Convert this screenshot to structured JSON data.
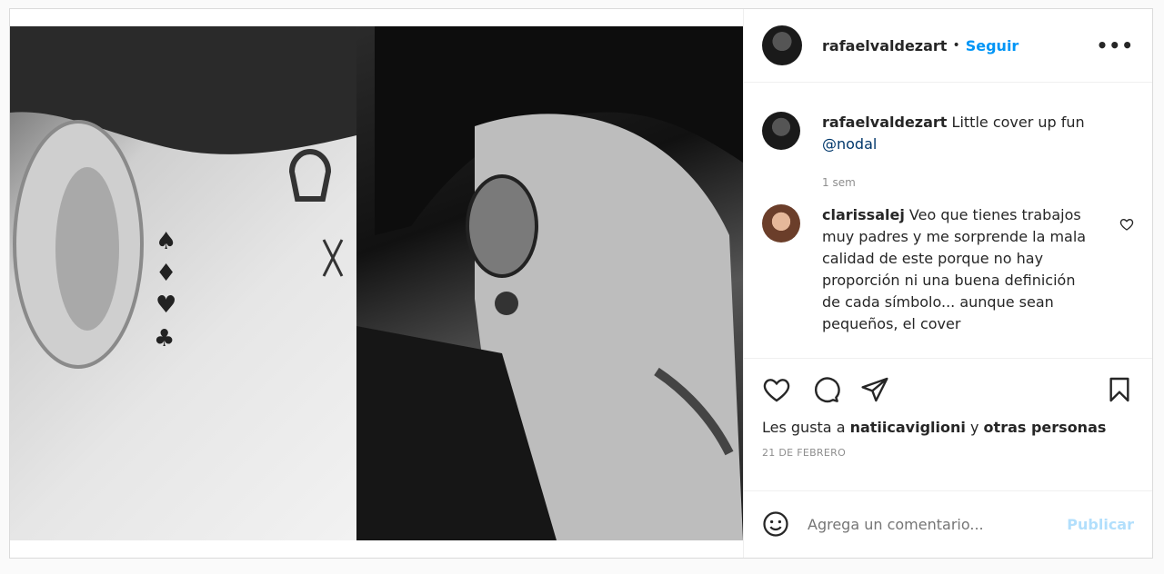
{
  "post": {
    "author": "rafaelvaldezart",
    "follow_label": "Seguir",
    "more_label": "•••"
  },
  "caption": {
    "user": "rafaelvaldezart",
    "text": "Little cover up fun",
    "mention": "@nodal",
    "time": "1 sem"
  },
  "comments": [
    {
      "user": "clarissalej",
      "text": "Veo que tienes trabajos muy padres y me sorprende la mala calidad de este porque no hay proporción ni una buena definición de cada símbolo... aunque sean pequeños, el cover"
    }
  ],
  "likes": {
    "prefix": "Les gusta a",
    "user": "natiicaviglioni",
    "conj": "y",
    "others": "otras personas"
  },
  "date": "21 DE FEBRERO",
  "add_comment": {
    "placeholder": "Agrega un comentario...",
    "publish_label": "Publicar"
  },
  "icons": [
    "heart-icon",
    "comment-icon",
    "share-icon",
    "bookmark-icon",
    "emoji-icon",
    "heart-small-icon",
    "more-icon"
  ]
}
